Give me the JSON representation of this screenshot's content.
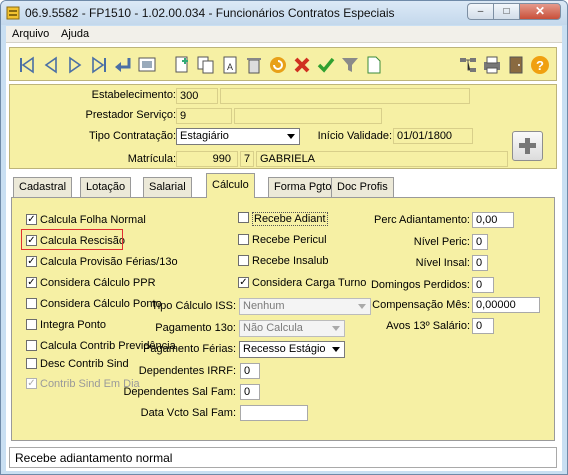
{
  "window": {
    "title": "06.9.5582 - FP1510 - 1.02.00.034 - Funcionários Contratos Especiais",
    "controls": {
      "minimize": "–",
      "maximize": "□",
      "close": "✕"
    }
  },
  "menu": {
    "items": [
      {
        "label": "Arquivo"
      },
      {
        "label": "Ajuda"
      }
    ]
  },
  "toolbar": {
    "buttons": [
      {
        "icon": "first-record-icon"
      },
      {
        "icon": "previous-record-icon"
      },
      {
        "icon": "next-record-icon"
      },
      {
        "icon": "last-record-icon"
      },
      {
        "icon": "return-icon"
      },
      {
        "icon": "view-icon"
      },
      {
        "icon": "new-record-icon"
      },
      {
        "icon": "copy-icon"
      },
      {
        "icon": "edit-icon"
      },
      {
        "icon": "delete-icon"
      },
      {
        "icon": "undo-icon"
      },
      {
        "icon": "cancel-icon"
      },
      {
        "icon": "confirm-icon"
      },
      {
        "icon": "filter-icon"
      },
      {
        "icon": "document-icon"
      },
      {
        "icon": "tree-icon"
      },
      {
        "icon": "print-icon"
      },
      {
        "icon": "exit-icon"
      },
      {
        "icon": "help-icon"
      }
    ]
  },
  "header": {
    "estabelecimento": {
      "label": "Estabelecimento:",
      "code": "300",
      "name": ""
    },
    "prestador": {
      "label": "Prestador Serviço:",
      "code": "9",
      "name": ""
    },
    "tipo_contratacao": {
      "label": "Tipo Contratação:",
      "value": "Estagiário"
    },
    "inicio_validade": {
      "label": "Início Validade:",
      "value": "01/01/1800"
    },
    "matricula": {
      "label": "Matrícula:",
      "code": "990",
      "digit": "7",
      "name": "GABRIELA"
    }
  },
  "tabs": [
    {
      "label": "Cadastral",
      "active": false
    },
    {
      "label": "Lotação",
      "active": false
    },
    {
      "label": "Salarial",
      "active": false
    },
    {
      "label": "Cálculo",
      "active": true
    },
    {
      "label": "Forma Pgto",
      "active": false
    },
    {
      "label": "Doc Profis",
      "active": false
    }
  ],
  "calculo": {
    "checkboxes_left": [
      {
        "label": "Calcula Folha Normal",
        "checked": true,
        "enabled": true
      },
      {
        "label": "Calcula Rescisão",
        "checked": true,
        "enabled": true
      },
      {
        "label": "Calcula Provisão Férias/13o",
        "checked": true,
        "enabled": true
      },
      {
        "label": "Considera Cálculo PPR",
        "checked": true,
        "enabled": true
      },
      {
        "label": "Considera Cálculo Ponto",
        "checked": false,
        "enabled": true
      },
      {
        "label": "Integra Ponto",
        "checked": false,
        "enabled": true
      },
      {
        "label": "Calcula Contrib Previdência",
        "checked": false,
        "enabled": true
      },
      {
        "label": "Desc Contrib Sind",
        "checked": false,
        "enabled": true
      },
      {
        "label": "Contrib Sind Em Dia",
        "checked": true,
        "enabled": false
      }
    ],
    "checkboxes_mid": [
      {
        "label": "Recebe Adiant",
        "checked": false
      },
      {
        "label": "Recebe Pericul",
        "checked": false
      },
      {
        "label": "Recebe Insalub",
        "checked": false
      },
      {
        "label": "Considera Carga Turno",
        "checked": true
      }
    ],
    "tipo_calculo_iss": {
      "label": "Tipo Cálculo ISS:",
      "value": "Nenhum"
    },
    "pagamento_13o": {
      "label": "Pagamento 13o:",
      "value": "Não Calcula"
    },
    "pagamento_ferias": {
      "label": "Pagamento Férias:",
      "value": "Recesso Estágio"
    },
    "dependentes_irrf": {
      "label": "Dependentes IRRF:",
      "value": "0"
    },
    "dependentes_sal_fam": {
      "label": "Dependentes Sal Fam:",
      "value": "0"
    },
    "data_vcto_sal_fam": {
      "label": "Data Vcto Sal Fam:",
      "value": ""
    },
    "perc_adiantamento": {
      "label": "Perc Adiantamento:",
      "value": "0,00"
    },
    "nivel_peric": {
      "label": "Nível Peric:",
      "value": "0"
    },
    "nivel_insal": {
      "label": "Nível Insal:",
      "value": "0"
    },
    "domingos_perdidos": {
      "label": "Domingos Perdidos:",
      "value": "0"
    },
    "compensacao_mes": {
      "label": "Compensação Mês:",
      "value": "0,00000"
    },
    "avos_13_salario": {
      "label": "Avos 13º Salário:",
      "value": "0"
    }
  },
  "status": {
    "text": "Recebe adiantamento normal"
  },
  "colors": {
    "panel": "#f6f0a4",
    "highlight": "#e03030"
  }
}
